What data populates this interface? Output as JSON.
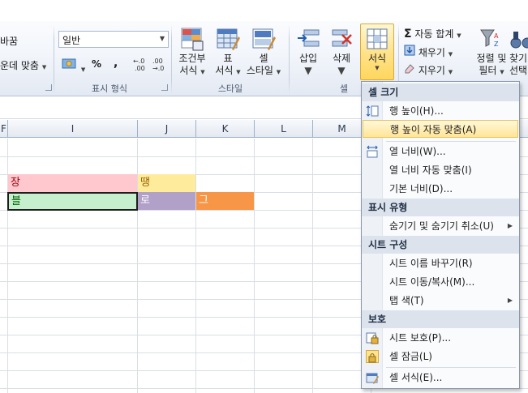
{
  "ribbon": {
    "alignment": {
      "wrap_partial": "바꿈",
      "merge_partial": "운데 맞춤"
    },
    "number": {
      "format_value": "일반",
      "group_label": "표시 형식",
      "percent": "%",
      "comma": ",",
      "inc_decimal": "←.0 .00",
      "dec_decimal": ".00 →.0"
    },
    "styles": {
      "conditional_label_1": "조건부",
      "conditional_label_2": "서식",
      "table_label_1": "표",
      "table_label_2": "서식",
      "cell_styles_label_1": "셀",
      "cell_styles_label_2": "스타일",
      "group_label": "스타일"
    },
    "cells": {
      "insert_label": "삽입",
      "delete_label": "삭제",
      "format_label": "서식",
      "group_label_partial": "셀"
    },
    "editing": {
      "autosum_label": "자동 합계",
      "fill_label": "채우기",
      "clear_label": "지우기",
      "sort_filter_1": "정렬 및",
      "sort_filter_2": "필터",
      "find_1": "찾기",
      "find_2": "선택"
    }
  },
  "grid": {
    "columns": [
      "F",
      "I",
      "J",
      "K",
      "L",
      "M"
    ],
    "cells": {
      "i12": "장",
      "j12": "땡",
      "i13": "블",
      "j13": "로",
      "k13": "그"
    },
    "colors": {
      "pink": "#ffc7ce",
      "yellow": "#ffeb9c",
      "green": "#c6efce",
      "purple": "#b1a0c7",
      "orange": "#f79646"
    }
  },
  "menu": {
    "sections": {
      "cell_size": "셀 크기",
      "visibility": "표시 유형",
      "organize": "시트 구성",
      "protection": "보호"
    },
    "items": {
      "row_height": "행 높이(H)...",
      "autofit_row": "행 높이 자동 맞춤(A)",
      "col_width": "열 너비(W)...",
      "autofit_col": "열 너비 자동 맞춤(I)",
      "default_width": "기본 너비(D)...",
      "hide_unhide": "숨기기 및 숨기기 취소(U)",
      "rename_sheet": "시트 이름 바꾸기(R)",
      "move_copy": "시트 이동/복사(M)...",
      "tab_color": "탭 색(T)",
      "protect_sheet": "시트 보호(P)...",
      "lock_cell": "셀 잠금(L)",
      "format_cells": "셀 서식(E)..."
    }
  }
}
